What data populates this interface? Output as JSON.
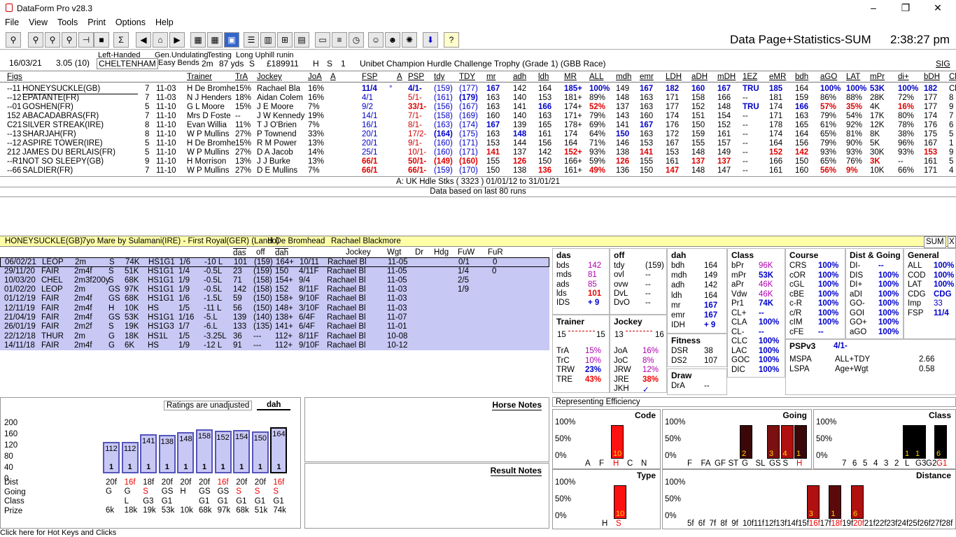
{
  "app": {
    "title": "DataForm Pro v28.3",
    "page_title": "Data Page+Statistics-SUM",
    "clock": "2:38:27 pm"
  },
  "menu": [
    "File",
    "View",
    "Tools",
    "Print",
    "Options",
    "Help"
  ],
  "race": {
    "date": "16/03/21",
    "time": "3.05 (10)",
    "handed": "Left-Handed",
    "course": "CHELTENHAM",
    "undulating": "Gen.Undulating",
    "bends": "Easy Bends",
    "testing": "Testing",
    "dist": "2m",
    "yds": "87 yds",
    "going": "S",
    "uphill": "Long Uphill runin",
    "prize": "£189911",
    "code": "H",
    "type": "S",
    "n": "1",
    "name": "Unibet Champion Hurdle Challenge Trophy (Grade 1) (GBB Race)",
    "sig": "SIG"
  },
  "columns": [
    "Figs",
    "Trainer",
    "TrA",
    "Jockey",
    "JoA",
    "A",
    "FSP",
    "A",
    "PSP",
    "tdy",
    "TDY",
    "mr",
    "adh",
    "ldh",
    "MR",
    "ALL",
    "mdh",
    "emr",
    "LDH",
    "aDH",
    "mDH",
    "1EZ",
    "eMR",
    "bdh",
    "aGO",
    "LAT",
    "mPr",
    "di+",
    "bDH",
    "Cl"
  ],
  "runners": [
    {
      "figs": "--11",
      "name": "HONEYSUCKLE(GB)",
      "age": "7",
      "wgt": "11-03",
      "trainer": "H De Bromhe",
      "tra": "15%",
      "jockey": "Rachael Bla",
      "joa": "16%",
      "fsp": "11/4",
      "psp": "4/1-",
      "tdy": "(159)",
      "TDY": "(177)",
      "mr": "167",
      "adh": "142",
      "ldh": "164",
      "MR": "185+",
      "ALL": "100%",
      "mdh": "149",
      "emr": "167",
      "LDH": "182",
      "aDH": "160",
      "mDH": "167",
      "ez": "TRU",
      "eMR": "185",
      "bdh": "164",
      "aGO": "100%",
      "LAT": "100%",
      "mPr": "53K",
      "di": "100%",
      "bDH": "182",
      "cl": "Cl"
    },
    {
      "figs": "--12",
      "name": "EPATANTE(FR)",
      "age": "7",
      "wgt": "11-03",
      "trainer": "N J Henders",
      "tra": "18%",
      "jockey": "Aidan Colem",
      "joa": "16%",
      "fsp": "4/1",
      "psp": "5/1-",
      "tdy": "(161)",
      "TDY": "(179)",
      "mr": "163",
      "adh": "140",
      "ldh": "153",
      "MR": "181+",
      "ALL": "89%",
      "mdh": "148",
      "emr": "163",
      "LDH": "171",
      "aDH": "158",
      "mDH": "166",
      "ez": "--",
      "eMR": "181",
      "bdh": "159",
      "aGO": "86%",
      "LAT": "88%",
      "mPr": "28K",
      "di": "72%",
      "bDH": "177",
      "cl": "8"
    },
    {
      "figs": "--01",
      "name": "GOSHEN(FR)",
      "age": "5",
      "wgt": "11-10",
      "trainer": "G L Moore",
      "tra": "15%",
      "jockey": "J E Moore",
      "joa": "7%",
      "fsp": "9/2",
      "psp": "33/1-",
      "tdy": "(156)",
      "TDY": "(167)",
      "mr": "163",
      "adh": "141",
      "ldh": "166",
      "MR": "174+",
      "ALL": "52%",
      "mdh": "137",
      "emr": "163",
      "LDH": "177",
      "aDH": "152",
      "mDH": "148",
      "ez": "TRU",
      "eMR": "174",
      "bdh": "166",
      "aGO": "57%",
      "LAT": "35%",
      "mPr": "4K",
      "di": "16%",
      "bDH": "177",
      "cl": "9"
    },
    {
      "figs": "152",
      "name": "ABACADABRAS(FR)",
      "age": "7",
      "wgt": "11-10",
      "trainer": "Mrs D Foste",
      "tra": "--",
      "jockey": "J W Kennedy",
      "joa": "19%",
      "fsp": "14/1",
      "psp": "7/1-",
      "tdy": "(158)",
      "TDY": "(169)",
      "mr": "160",
      "adh": "140",
      "ldh": "163",
      "MR": "171+",
      "ALL": "79%",
      "mdh": "143",
      "emr": "160",
      "LDH": "174",
      "aDH": "151",
      "mDH": "154",
      "ez": "--",
      "eMR": "171",
      "bdh": "163",
      "aGO": "79%",
      "LAT": "54%",
      "mPr": "17K",
      "di": "80%",
      "bDH": "174",
      "cl": "7"
    },
    {
      "figs": "C21",
      "name": "SILVER STREAK(IRE)",
      "age": "8",
      "wgt": "11-10",
      "trainer": "Evan Willia",
      "tra": "11%",
      "jockey": "T J O'Brien",
      "joa": "7%",
      "fsp": "16/1",
      "psp": "8/1-",
      "tdy": "(163)",
      "TDY": "(174)",
      "mr": "167",
      "adh": "139",
      "ldh": "165",
      "MR": "178+",
      "ALL": "69%",
      "mdh": "141",
      "emr": "167",
      "LDH": "176",
      "aDH": "150",
      "mDH": "152",
      "ez": "--",
      "eMR": "178",
      "bdh": "165",
      "aGO": "61%",
      "LAT": "92%",
      "mPr": "12K",
      "di": "78%",
      "bDH": "176",
      "cl": "6"
    },
    {
      "figs": "--13",
      "name": "SHARJAH(FR)",
      "age": "8",
      "wgt": "11-10",
      "trainer": "W P Mullins",
      "tra": "27%",
      "jockey": "P Townend",
      "joa": "33%",
      "fsp": "20/1",
      "psp": "17/2-",
      "tdy": "(164)",
      "TDY": "(175)",
      "mr": "163",
      "adh": "148",
      "ldh": "161",
      "MR": "174",
      "ALL": "64%",
      "mdh": "150",
      "emr": "163",
      "LDH": "172",
      "aDH": "159",
      "mDH": "161",
      "ez": "--",
      "eMR": "174",
      "bdh": "164",
      "aGO": "65%",
      "LAT": "81%",
      "mPr": "8K",
      "di": "38%",
      "bDH": "175",
      "cl": "5"
    },
    {
      "figs": "--12",
      "name": "ASPIRE TOWER(IRE)",
      "age": "5",
      "wgt": "11-10",
      "trainer": "H De Bromhe",
      "tra": "15%",
      "jockey": "R M Power",
      "joa": "13%",
      "fsp": "20/1",
      "psp": "9/1-",
      "tdy": "(160)",
      "TDY": "(171)",
      "mr": "153",
      "adh": "144",
      "ldh": "156",
      "MR": "164",
      "ALL": "71%",
      "mdh": "146",
      "emr": "153",
      "LDH": "167",
      "aDH": "155",
      "mDH": "157",
      "ez": "--",
      "eMR": "164",
      "bdh": "156",
      "aGO": "79%",
      "LAT": "90%",
      "mPr": "5K",
      "di": "96%",
      "bDH": "167",
      "cl": "1"
    },
    {
      "figs": "212",
      "name": "JAMES DU BERLAIS(FR)",
      "age": "5",
      "wgt": "11-10",
      "trainer": "W P Mullins",
      "tra": "27%",
      "jockey": "D A Jacob",
      "joa": "14%",
      "fsp": "25/1",
      "psp": "10/1-",
      "tdy": "(160)",
      "TDY": "(171)",
      "mr": "141",
      "adh": "137",
      "ldh": "142",
      "MR": "152+",
      "ALL": "93%",
      "mdh": "138",
      "emr": "141",
      "LDH": "153",
      "aDH": "148",
      "mDH": "149",
      "ez": "--",
      "eMR": "152",
      "bdh": "142",
      "aGO": "93%",
      "LAT": "93%",
      "mPr": "30K",
      "di": "93%",
      "bDH": "153",
      "cl": "9"
    },
    {
      "figs": "--R1",
      "name": "NOT SO SLEEPY(GB)",
      "age": "9",
      "wgt": "11-10",
      "trainer": "H Morrison",
      "tra": "13%",
      "jockey": "J J Burke",
      "joa": "13%",
      "fsp": "66/1",
      "psp": "50/1-",
      "tdy": "(149)",
      "TDY": "(160)",
      "mr": "155",
      "adh": "126",
      "ldh": "150",
      "MR": "166+",
      "ALL": "59%",
      "mdh": "126",
      "emr": "155",
      "LDH": "161",
      "aDH": "137",
      "mDH": "137",
      "ez": "--",
      "eMR": "166",
      "bdh": "150",
      "aGO": "65%",
      "LAT": "76%",
      "mPr": "3K",
      "di": "--",
      "bDH": "161",
      "cl": "5"
    },
    {
      "figs": "--66",
      "name": "SALDIER(FR)",
      "age": "7",
      "wgt": "11-10",
      "trainer": "W P Mullins",
      "tra": "27%",
      "jockey": "D E Mullins",
      "joa": "7%",
      "fsp": "66/1",
      "psp": "66/1-",
      "tdy": "(159)",
      "TDY": "(170)",
      "mr": "150",
      "adh": "138",
      "ldh": "136",
      "MR": "161+",
      "ALL": "49%",
      "mdh": "136",
      "emr": "150",
      "LDH": "147",
      "aDH": "148",
      "mDH": "147",
      "ez": "--",
      "eMR": "161",
      "bdh": "160",
      "aGO": "56%",
      "LAT": "9%",
      "mPr": "10K",
      "di": "66%",
      "bDH": "171",
      "cl": "4"
    }
  ],
  "filter_line": "A: UK Hdle Stks ( 3323 )   01/01/12 to 31/01/21",
  "runs_line": "Data based on last 80 runs",
  "horse": {
    "name": "HONEYSUCKLE(GB)",
    "desc": "7yo Mare by Sulamani(IRE) - First Royal(GER) (Lando)",
    "trainer": "H De Bromhead",
    "jockey": "Rachael Blackmore",
    "sum": "SUM",
    "close": "X"
  },
  "form_headers": [
    "das",
    "off",
    "dah",
    "Jockey",
    "Wgt",
    "Dr",
    "Hdg",
    "FuW",
    "FuR"
  ],
  "form": [
    [
      "06/02/21",
      "LEOP",
      "2m",
      "S",
      "74K",
      "HS1G1",
      "1/6",
      "-10 L",
      "101",
      "(159)",
      "164+",
      "10/11",
      "Rachael Bl",
      "11-05",
      "",
      "",
      "0/1",
      "0"
    ],
    [
      "29/11/20",
      "FAIR",
      "2m4f",
      "S",
      "51K",
      "HS1G1",
      "1/4",
      "-0.5L",
      "23",
      "(159)",
      "150",
      "4/11F",
      "Rachael Bl",
      "11-05",
      "",
      "",
      "1/4",
      "0"
    ],
    [
      "10/03/20",
      "CHEL",
      "2m3f200y",
      "S",
      "68K",
      "HS1G1",
      "1/9",
      "-0.5L",
      "71",
      "(158)",
      "154+",
      "9/4",
      "Rachael Bl",
      "11-05",
      "",
      "",
      "2/5",
      ""
    ],
    [
      "01/02/20",
      "LEOP",
      "2m",
      "GS",
      "97K",
      "HS1G1",
      "1/9",
      "-0.5L",
      "142",
      "(158)",
      "152",
      "8/11F",
      "Rachael Bl",
      "11-03",
      "",
      "",
      "1/9",
      ""
    ],
    [
      "01/12/19",
      "FAIR",
      "2m4f",
      "GS",
      "68K",
      "HS1G1",
      "1/6",
      "-1.5L",
      "59",
      "(150)",
      "158+",
      "9/10F",
      "Rachael Bl",
      "11-03",
      "",
      "",
      "",
      ""
    ],
    [
      "12/11/19",
      "FAIR",
      "2m4f",
      "H",
      "10K",
      "HS",
      "1/5",
      "-11 L",
      "56",
      "(150)",
      "148+",
      "3/10F",
      "Rachael Bl",
      "11-03",
      "",
      "",
      "",
      ""
    ],
    [
      "21/04/19",
      "FAIR",
      "2m4f",
      "GS",
      "53K",
      "HS1G1",
      "1/16",
      "-5.L",
      "139",
      "(140)",
      "138+",
      "6/4F",
      "Rachael Bl",
      "11-07",
      "",
      "",
      "",
      ""
    ],
    [
      "26/01/19",
      "FAIR",
      "2m2f",
      "S",
      "19K",
      "HS1G3",
      "1/7",
      "-6.L",
      "133",
      "(135)",
      "141+",
      "6/4F",
      "Rachael Bl",
      "11-01",
      "",
      "",
      "",
      ""
    ],
    [
      "22/12/18",
      "THUR",
      "2m",
      "G",
      "18K",
      "HS1L",
      "1/5",
      "-3.25L",
      "36",
      "---",
      "112+",
      "8/11F",
      "Rachael Bl",
      "10-08",
      "",
      "",
      "",
      ""
    ],
    [
      "14/11/18",
      "FAIR",
      "2m4f",
      "G",
      "6K",
      "HS",
      "1/9",
      "-12 L",
      "91",
      "---",
      "112+",
      "9/10F",
      "Rachael Bl",
      "10-12",
      "",
      "",
      "",
      ""
    ]
  ],
  "stats": {
    "das": {
      "title": "das",
      "items": [
        [
          "bds",
          "142"
        ],
        [
          "mds",
          "81"
        ],
        [
          "ads",
          "85"
        ],
        [
          "lds",
          "101"
        ],
        [
          "IDS",
          "+ 9"
        ]
      ]
    },
    "off": {
      "title": "off",
      "items": [
        [
          "tdy",
          "(159)"
        ],
        [
          "ovl",
          "--"
        ],
        [
          "ovw",
          "--"
        ],
        [
          "DvL",
          "--"
        ],
        [
          "DvO",
          "--"
        ]
      ]
    },
    "dah": {
      "title": "dah",
      "items": [
        [
          "bdh",
          "164"
        ],
        [
          "mdh",
          "149"
        ],
        [
          "adh",
          "142"
        ],
        [
          "ldh",
          "164"
        ],
        [
          "mr",
          "167"
        ],
        [
          "emr",
          "167"
        ],
        [
          "IDH",
          "+ 9"
        ]
      ]
    },
    "class": {
      "title": "Class",
      "items": [
        [
          "bPr",
          "96K"
        ],
        [
          "mPr",
          "53K"
        ],
        [
          "aPr",
          "46K"
        ],
        [
          "Vdw",
          "46K"
        ],
        [
          "Pr1",
          "74K"
        ],
        [
          "CL+",
          "--"
        ],
        [
          "CLA",
          "100%"
        ],
        [
          "CL-",
          "--"
        ],
        [
          "CLC",
          "100%"
        ],
        [
          "LAC",
          "100%"
        ],
        [
          "GOC",
          "100%"
        ],
        [
          "DIC",
          "100%"
        ]
      ]
    },
    "course": {
      "title": "Course",
      "items": [
        [
          "CRS",
          "100%"
        ],
        [
          "cOR",
          "100%"
        ],
        [
          "cGL",
          "100%"
        ],
        [
          "cBE",
          "100%"
        ],
        [
          "c-R",
          "100%"
        ],
        [
          "c/R",
          "100%"
        ],
        [
          "cIM",
          "100%"
        ],
        [
          "cFE",
          "--"
        ]
      ]
    },
    "distgoing": {
      "title": "Dist & Going",
      "items": [
        [
          "DI-",
          "--"
        ],
        [
          "DIS",
          "100%"
        ],
        [
          "DI+",
          "100%"
        ],
        [
          "aDI",
          "100%"
        ],
        [
          "GO-",
          "100%"
        ],
        [
          "GOI",
          "100%"
        ],
        [
          "GO+",
          "100%"
        ],
        [
          "aGO",
          "100%"
        ]
      ]
    },
    "general": {
      "title": "General",
      "items": [
        [
          "ALL",
          "100%"
        ],
        [
          "COD",
          "100%"
        ],
        [
          "LAT",
          "100%"
        ],
        [
          "CDG",
          "CDG"
        ],
        [
          "Imp",
          "33"
        ],
        [
          "FSP",
          "11/4"
        ]
      ]
    },
    "trainer": {
      "title": "Trainer",
      "left": "15",
      "right": "15",
      "items": [
        [
          "TrA",
          "15%"
        ],
        [
          "TrC",
          "10%"
        ],
        [
          "TRW",
          "23%"
        ],
        [
          "TRE",
          "43%"
        ]
      ]
    },
    "jockey": {
      "title": "Jockey",
      "left": "13",
      "right": "16",
      "items": [
        [
          "JoA",
          "16%"
        ],
        [
          "JoC",
          "8%"
        ],
        [
          "JRW",
          "12%"
        ],
        [
          "JRE",
          "38%"
        ],
        [
          "JKH",
          "✓"
        ]
      ]
    },
    "fitness": {
      "title": "Fitness",
      "items": [
        [
          "DSR",
          "38"
        ],
        [
          "DS2",
          "107"
        ]
      ]
    },
    "draw": {
      "title": "Draw",
      "items": [
        [
          "DrA",
          "--"
        ]
      ]
    },
    "pspv3": {
      "title": "PSPv3",
      "value": "4/1-",
      "items": [
        [
          "MSPA",
          "ALL+TDY",
          "2.66"
        ],
        [
          "LSPA",
          "Age+Wgt",
          "0.58"
        ]
      ]
    }
  },
  "ratings": {
    "label": "Ratings are unadjusted",
    "metric": "dah",
    "yaxis": [
      "200",
      "160",
      "120",
      "80",
      "40",
      "0"
    ],
    "values": [
      112,
      112,
      141,
      138,
      148,
      158,
      152,
      154,
      150,
      164
    ],
    "pos": [
      "1",
      "1",
      "1",
      "1",
      "1",
      "1",
      "1",
      "1",
      "1",
      "1"
    ],
    "dist": [
      "20f",
      "16f",
      "18f",
      "20f",
      "20f",
      "20f",
      "16f",
      "20f",
      "20f",
      "16f"
    ],
    "going": [
      "G",
      "G",
      "S",
      "GS",
      "H",
      "GS",
      "GS",
      "S",
      "S",
      "S"
    ],
    "class": [
      "",
      "L",
      "G3",
      "G1",
      "",
      "G1",
      "G1",
      "G1",
      "G1",
      "G1"
    ],
    "prize": [
      "6k",
      "18k",
      "19k",
      "53k",
      "10k",
      "68k",
      "97k",
      "68k",
      "51k",
      "74k"
    ],
    "row_labels": [
      "Dist",
      "Going",
      "Class",
      "Prize"
    ]
  },
  "notes": {
    "horse": "Horse Notes",
    "result": "Result Notes"
  },
  "efficiency": {
    "title": "Representing Efficiency",
    "pct": [
      "100%",
      "50%",
      "0%"
    ],
    "code": {
      "title": "Code",
      "labels": [
        "A",
        "F",
        "H",
        "C",
        "N"
      ],
      "values": [
        0,
        0,
        100,
        0,
        0
      ],
      "counts": [
        "",
        "",
        "10",
        "",
        ""
      ]
    },
    "going": {
      "title": "Going",
      "labels": [
        "F",
        "FA",
        "GF",
        "ST",
        "G",
        "SL",
        "GS",
        "S",
        "H"
      ],
      "values": [
        0,
        0,
        0,
        0,
        100,
        0,
        100,
        100,
        100
      ],
      "counts": [
        "",
        "",
        "",
        "",
        "2",
        "",
        "3",
        "4",
        "1"
      ]
    },
    "class": {
      "title": "Class",
      "labels": [
        "7",
        "6",
        "5",
        "4",
        "3",
        "2",
        "L",
        "G3",
        "G2",
        "G1"
      ],
      "values": [
        0,
        0,
        0,
        0,
        0,
        0,
        100,
        100,
        0,
        100
      ],
      "counts": [
        "",
        "",
        "",
        "",
        "",
        "",
        "1",
        "1",
        "",
        "6"
      ]
    },
    "type": {
      "title": "Type",
      "labels": [
        "H",
        "S"
      ],
      "values": [
        0,
        100
      ],
      "counts": [
        "",
        "10"
      ]
    },
    "distance": {
      "title": "Distance",
      "labels": [
        "5f",
        "6f",
        "7f",
        "8f",
        "9f",
        "10f",
        "11f",
        "12f",
        "13f",
        "14f",
        "15f",
        "16f",
        "17f",
        "18f",
        "19f",
        "20f",
        "21f",
        "22f",
        "23f",
        "24f",
        "25f",
        "26f",
        "27f",
        "28f"
      ],
      "values": [
        0,
        0,
        0,
        0,
        0,
        0,
        0,
        0,
        0,
        0,
        0,
        100,
        0,
        100,
        0,
        100,
        0,
        0,
        0,
        0,
        0,
        0,
        0,
        0
      ],
      "counts": [
        "",
        "",
        "",
        "",
        "",
        "",
        "",
        "",
        "",
        "",
        "",
        "3",
        "",
        "1",
        "",
        "6",
        "",
        "",
        "",
        "",
        "",
        "",
        "",
        ""
      ]
    }
  },
  "statusbar": "Click here for Hot Keys and Clicks"
}
